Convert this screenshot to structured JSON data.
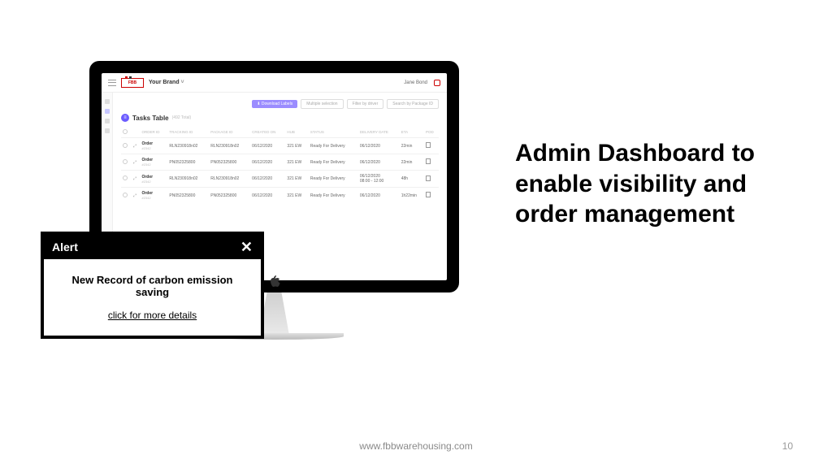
{
  "header": {
    "logo_text": "FBB",
    "brand": "Your Brand",
    "user": "Jane Bond"
  },
  "toolbar": {
    "download": "⬇ Download Labels",
    "multi": "Multiple selection",
    "filter": "Filter by driver",
    "search": "Search by Package ID"
  },
  "tasks": {
    "title": "Tasks Table",
    "subtitle": "(492 Total)",
    "columns": {
      "order": "ORDER ID",
      "tracking": "TRACKING ID",
      "package": "PACKAGE ID",
      "created": "CREATED ON",
      "hub": "HUB",
      "status": "STATUS",
      "date": "DELIVERY DATE",
      "eta": "ETA",
      "pod": "POD"
    },
    "rows": [
      {
        "order": "Order",
        "order_sub": "#2342",
        "tracking": "RLN230918n02",
        "package": "RLN230918n02",
        "created": "06/12/2020",
        "hub": "321 EW",
        "status": "Ready For Delivery",
        "date": "06/12/2020",
        "eta": "22min"
      },
      {
        "order": "Order",
        "order_sub": "#2342",
        "tracking": "PN052325800",
        "package": "PN052325800",
        "created": "06/12/2020",
        "hub": "321 EW",
        "status": "Ready For Delivery",
        "date": "06/12/2020",
        "eta": "22min"
      },
      {
        "order": "Order",
        "order_sub": "#2342",
        "tracking": "RLN230918n02",
        "package": "RLN230918n02",
        "created": "06/12/2020",
        "hub": "321 EW",
        "status": "Ready For Delivery",
        "date": "06/12/2020\n08:00 - 12:00",
        "eta": "48h"
      },
      {
        "order": "Order",
        "order_sub": "#2342",
        "tracking": "PN052325800",
        "package": "PN052325800",
        "created": "06/12/2020",
        "hub": "321 EW",
        "status": "Ready For Delivery",
        "date": "06/12/2020",
        "eta": "1h22min"
      }
    ]
  },
  "alert": {
    "title": "Alert",
    "message": "New Record of carbon emission saving",
    "link": "click for more details"
  },
  "headline": "Admin Dashboard to enable visibility and order management",
  "footer": {
    "url": "www.fbbwarehousing.com",
    "page": "10"
  }
}
